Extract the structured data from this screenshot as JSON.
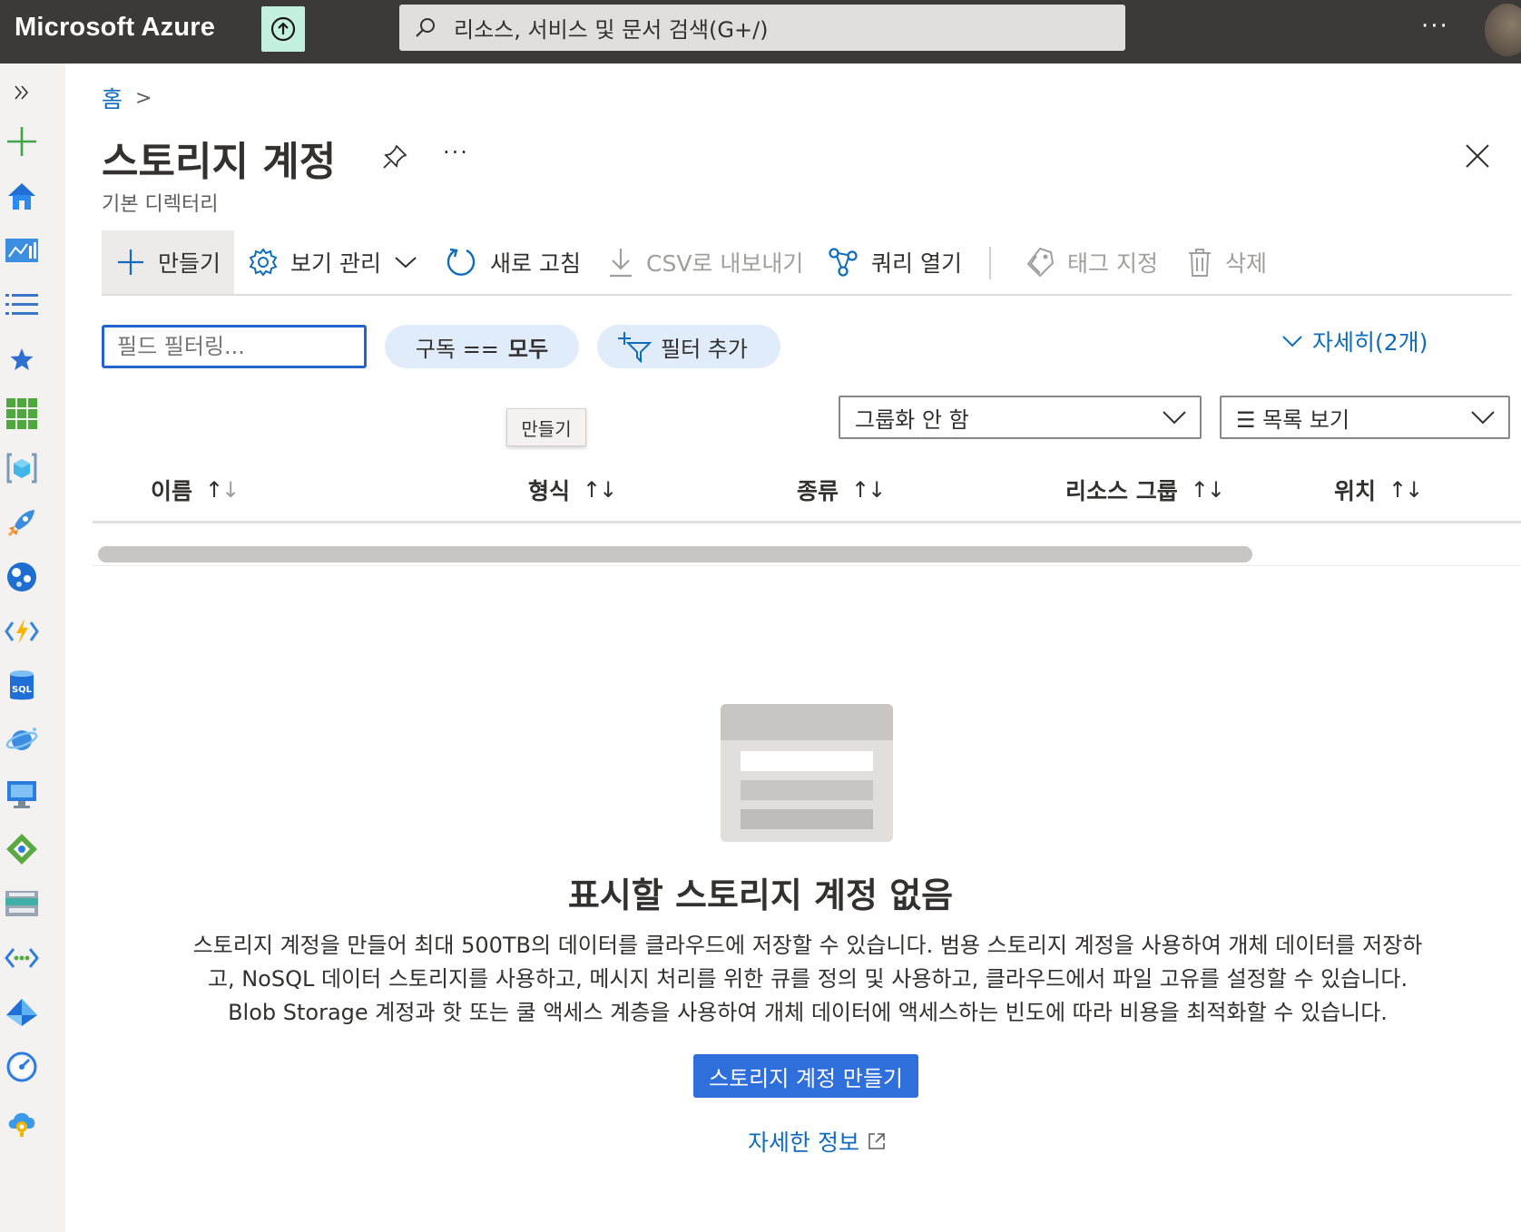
{
  "topbar": {
    "brand": "Microsoft Azure",
    "search_placeholder": "리소스, 서비스 및 문서 검색(G+/)",
    "more": "···"
  },
  "leftnav": {
    "expand_icon": "chevron-double-right-icon",
    "items": [
      {
        "icon": "plus-icon"
      },
      {
        "icon": "home-icon"
      },
      {
        "icon": "dashboard-icon"
      },
      {
        "icon": "list-icon"
      },
      {
        "icon": "star-icon"
      },
      {
        "icon": "grid-icon"
      },
      {
        "icon": "resource-group-icon"
      },
      {
        "icon": "rocket-icon"
      },
      {
        "icon": "globe-icon"
      },
      {
        "icon": "function-icon"
      },
      {
        "icon": "sql-icon"
      },
      {
        "icon": "cosmos-icon"
      },
      {
        "icon": "monitor-icon"
      },
      {
        "icon": "network-icon"
      },
      {
        "icon": "storage-icon"
      },
      {
        "icon": "vnet-icon"
      },
      {
        "icon": "diamond-icon"
      },
      {
        "icon": "gauge-icon"
      },
      {
        "icon": "cloud-gear-icon"
      }
    ],
    "sql_label": "SQL"
  },
  "breadcrumb": {
    "home": "홈",
    "sep": ">"
  },
  "page": {
    "title": "스토리지 계정",
    "subtitle": "기본 디렉터리",
    "more": "···"
  },
  "toolbar": {
    "create": "만들기",
    "manage_view": "보기 관리",
    "refresh": "새로 고침",
    "export_csv": "CSV로 내보내기",
    "open_query": "쿼리 열기",
    "assign_tags": "태그 지정",
    "delete": "삭제"
  },
  "filters": {
    "field_filter_placeholder": "필드 필터링...",
    "subscription_label": "구독 ==",
    "subscription_value": "모두",
    "add_filter": "필터 추가",
    "details": "자세히(2개)"
  },
  "tooltip": "만들기",
  "dropdowns": {
    "grouping": "그룹화 안 함",
    "view": "☰ 목록 보기"
  },
  "columns": [
    {
      "label": "이름"
    },
    {
      "label": "형식"
    },
    {
      "label": "종류"
    },
    {
      "label": "리소스 그룹"
    },
    {
      "label": "위치"
    }
  ],
  "empty": {
    "title": "표시할 스토리지 계정 없음",
    "desc_line1": "스토리지 계정을 만들어 최대 500TB의 데이터를 클라우드에 저장할 수 있습니다. 범용 스토리지 계정을 사용하여 개체 데이터를 저장하",
    "desc_line2": "고, NoSQL 데이터 스토리지를 사용하고, 메시지 처리를 위한 큐를 정의 및 사용하고, 클라우드에서 파일 고유를 설정할 수 있습니다.",
    "desc_line3": "Blob Storage 계정과 핫 또는 쿨 액세스 계층을 사용하여 개체 데이터에 액세스하는 빈도에 따라 비용을 최적화할 수 있습니다.",
    "create_button": "스토리지 계정 만들기",
    "learn_more": "자세한 정보"
  },
  "colors": {
    "accent": "#0f6cbd",
    "primary_button": "#2f6fdc",
    "topbar": "#3b3a39"
  }
}
